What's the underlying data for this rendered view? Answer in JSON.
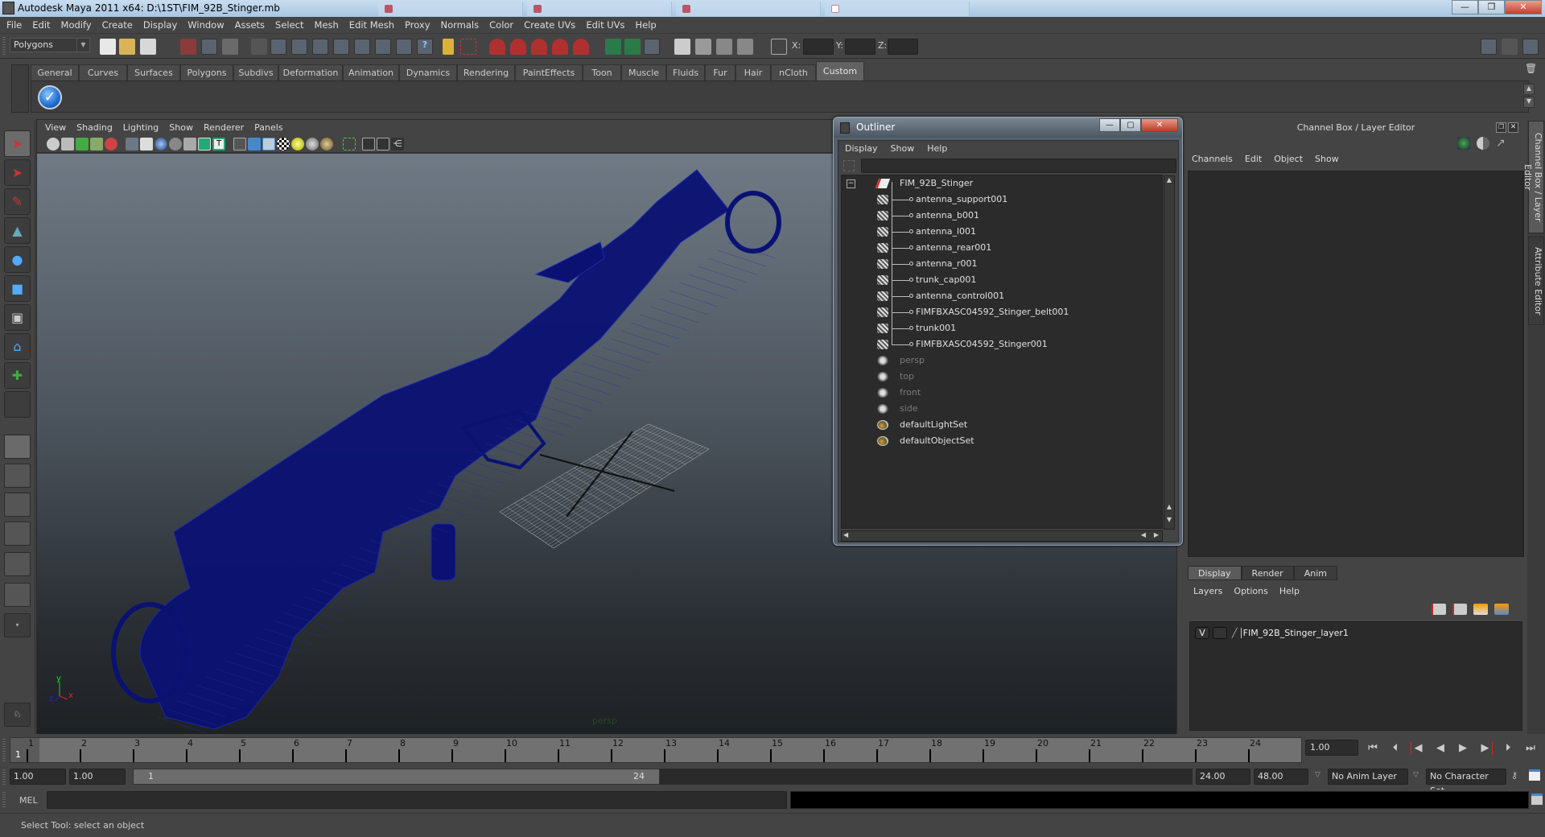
{
  "window": {
    "title": "Autodesk Maya 2011 x64: D:\\1ST\\FIM_92B_Stinger.mb",
    "controls": {
      "minimize": "—",
      "restore": "❐",
      "close": "✕"
    }
  },
  "menubar": [
    "File",
    "Edit",
    "Modify",
    "Create",
    "Display",
    "Window",
    "Assets",
    "Select",
    "Mesh",
    "Edit Mesh",
    "Proxy",
    "Normals",
    "Color",
    "Create UVs",
    "Edit UVs",
    "Help"
  ],
  "statusline": {
    "mode": "Polygons",
    "coords": {
      "x_label": "X:",
      "y_label": "Y:",
      "z_label": "Z:",
      "x": "",
      "y": "",
      "z": ""
    }
  },
  "shelf": {
    "tabs": [
      "General",
      "Curves",
      "Surfaces",
      "Polygons",
      "Subdivs",
      "Deformation",
      "Animation",
      "Dynamics",
      "Rendering",
      "PaintEffects",
      "Toon",
      "Muscle",
      "Fluids",
      "Fur",
      "Hair",
      "nCloth",
      "Custom"
    ],
    "active_tab": "Custom",
    "items": [
      {
        "icon": "checkmark-icon"
      }
    ]
  },
  "toolbox": {
    "tools": [
      "select-tool",
      "lasso-tool",
      "paint-select-tool",
      "move-tool",
      "rotate-tool",
      "scale-tool",
      "manipulator-tool",
      "soft-mod-tool",
      "last-tool",
      "empty-slot"
    ],
    "selected": "select-tool"
  },
  "viewport": {
    "menu": [
      "View",
      "Shading",
      "Lighting",
      "Show",
      "Renderer",
      "Panels"
    ],
    "camera_label": "persp",
    "axis": {
      "x": "x",
      "y": "y",
      "z": "z"
    },
    "wireframe_color": "#0a1173"
  },
  "outliner": {
    "title": "Outliner",
    "menu": [
      "Display",
      "Show",
      "Help"
    ],
    "filter_value": "",
    "root": {
      "name": "FIM_92B_Stinger",
      "expanded": true
    },
    "children": [
      "antenna_support001",
      "antenna_b001",
      "antenna_l001",
      "antenna_rear001",
      "antenna_r001",
      "trunk_cap001",
      "antenna_control001",
      "FIMFBXASC04592_Stinger_belt001",
      "trunk001",
      "FIMFBXASC04592_Stinger001"
    ],
    "cameras": [
      "persp",
      "top",
      "front",
      "side"
    ],
    "sets": [
      "defaultLightSet",
      "defaultObjectSet"
    ]
  },
  "channel_box": {
    "title": "Channel Box / Layer Editor",
    "menu": [
      "Channels",
      "Edit",
      "Object",
      "Show"
    ]
  },
  "layer_editor": {
    "tabs": [
      "Display",
      "Render",
      "Anim"
    ],
    "active_tab": "Display",
    "menu": [
      "Layers",
      "Options",
      "Help"
    ],
    "layers": [
      {
        "visible": "V",
        "template": "",
        "name": "FIM_92B_Stinger_layer1"
      }
    ]
  },
  "side_tabs": [
    "Channel Box / Layer Editor",
    "Attribute Editor"
  ],
  "timeline": {
    "ticks": [
      "1",
      "2",
      "3",
      "4",
      "5",
      "6",
      "7",
      "8",
      "9",
      "10",
      "11",
      "12",
      "13",
      "14",
      "15",
      "16",
      "17",
      "18",
      "19",
      "20",
      "21",
      "22",
      "23",
      "24"
    ],
    "current_frame_marker": "1",
    "current_frame": "1.00",
    "playback_buttons": [
      "go-to-start",
      "step-back-frame",
      "step-back-key",
      "play-backwards",
      "play-forwards",
      "step-forward-key",
      "step-forward-frame",
      "go-to-end"
    ]
  },
  "range": {
    "start_time": "1.00",
    "playback_start": "1.00",
    "slider_start": "1",
    "slider_end": "24",
    "playback_end": "24.00",
    "end_time": "48.00",
    "anim_layer": "No Anim Layer",
    "character_set": "No Character Set"
  },
  "command_line": {
    "label": "MEL",
    "input": "",
    "output": ""
  },
  "help_line": "Select Tool: select an object"
}
